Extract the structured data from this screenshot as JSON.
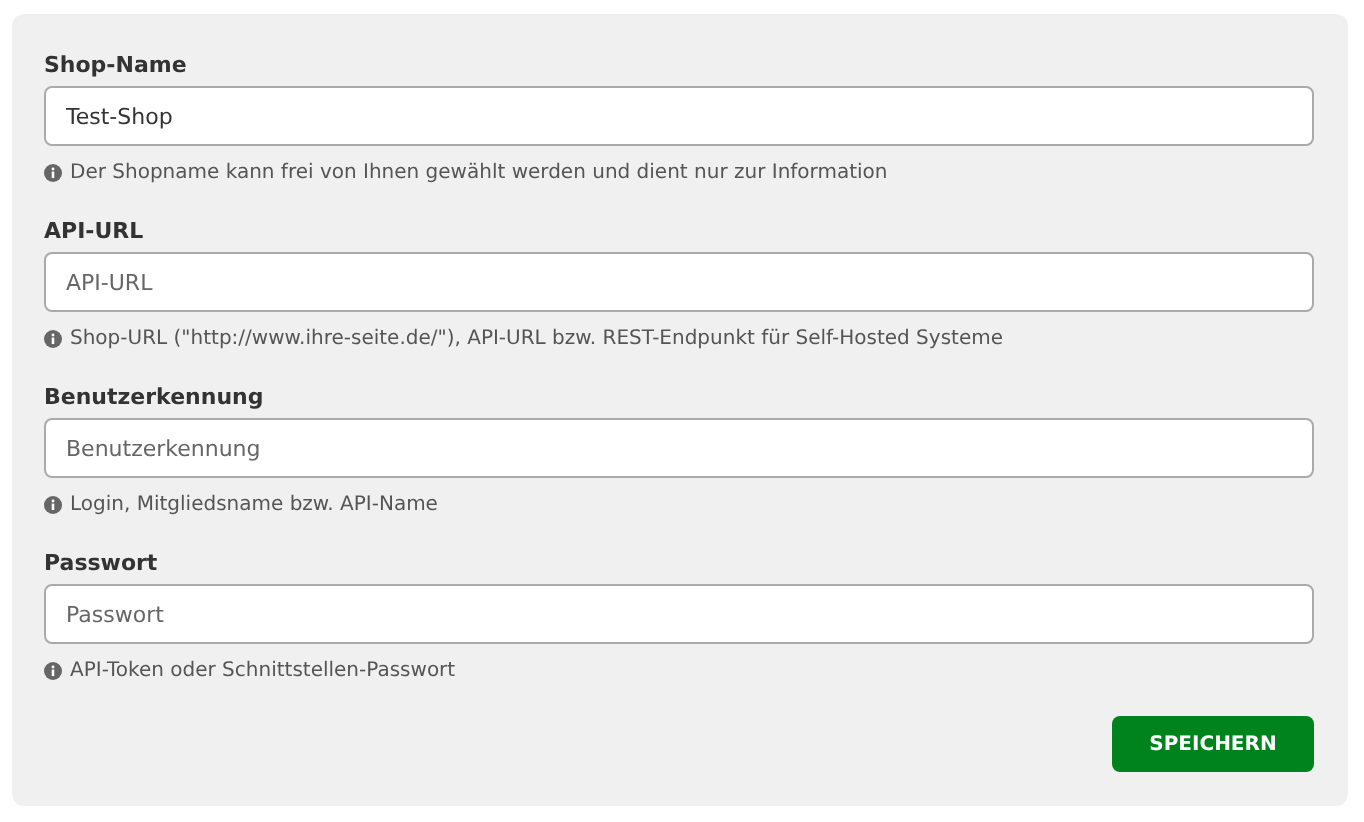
{
  "fields": [
    {
      "label": "Shop-Name",
      "value": "Test-Shop",
      "hint": "Der Shopname kann frei von Ihnen gewählt werden und dient nur zur Information"
    },
    {
      "label": "API-URL",
      "placeholder": "API-URL",
      "hint": "Shop-URL (\"http://www.ihre-seite.de/\"), API-URL bzw. REST-Endpunkt für Self-Hosted Systeme"
    },
    {
      "label": "Benutzerkennung",
      "placeholder": "Benutzerkennung",
      "hint": "Login, Mitgliedsname bzw. API-Name"
    },
    {
      "label": "Passwort",
      "placeholder": "Passwort",
      "hint": "API-Token oder Schnittstellen-Passwort"
    }
  ],
  "save_button": "SPEICHERN"
}
